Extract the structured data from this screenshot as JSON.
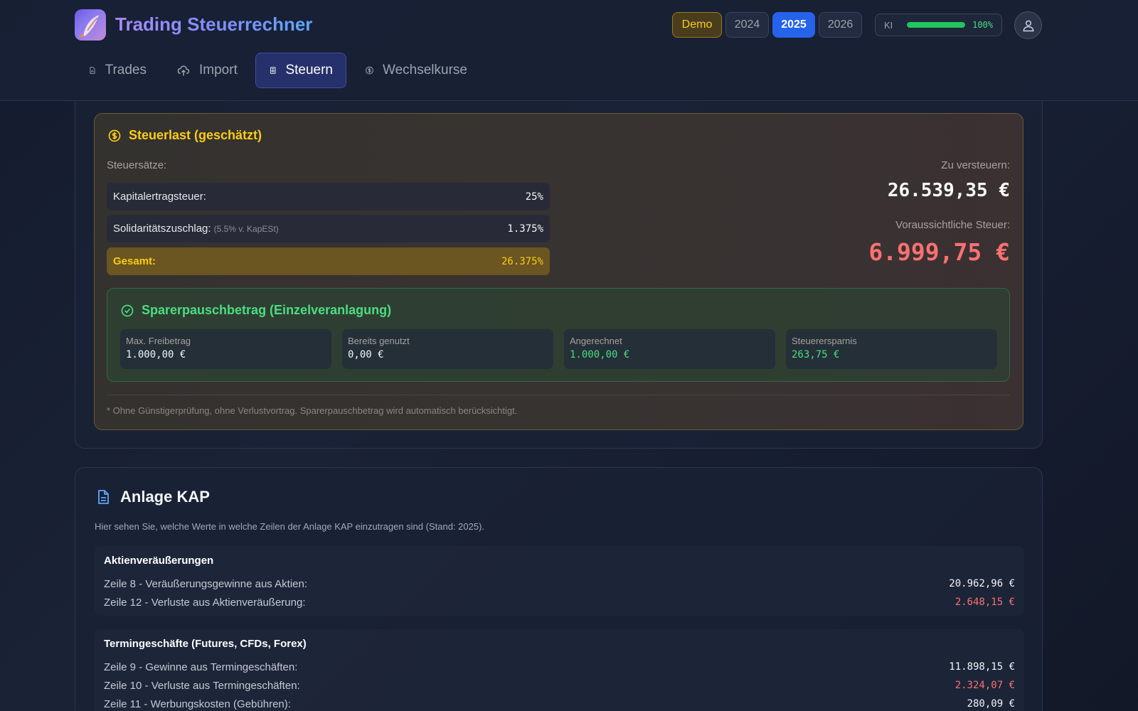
{
  "header": {
    "app_title": "Trading Steuerrechner",
    "badges": {
      "demo": "Demo"
    },
    "years": [
      "2024",
      "2025",
      "2026"
    ],
    "active_year": "2025",
    "ki": {
      "label": "KI",
      "percent_text": "100%",
      "level": 1.0
    },
    "nav": [
      {
        "label": "Trades",
        "icon": "chart-file-icon"
      },
      {
        "label": "Import",
        "icon": "upload-cloud-icon"
      },
      {
        "label": "Steuern",
        "icon": "calculator-icon"
      },
      {
        "label": "Wechselkurse",
        "icon": "dollar-circle-icon"
      }
    ],
    "active_nav": "Steuern"
  },
  "tax": {
    "title": "Steuerlast (geschätzt)",
    "rates_label": "Steuersätze:",
    "rates": [
      {
        "label": "Kapitalertragsteuer:",
        "hint": "",
        "value": "25%"
      },
      {
        "label": "Solidaritätszuschlag:",
        "hint": "(5.5% v. KapESt)",
        "value": "1.375%"
      },
      {
        "label": "Gesamt:",
        "hint": "",
        "value": "26.375%"
      }
    ],
    "taxable_label": "Zu versteuern:",
    "taxable_value": "26.539,35 €",
    "expected_label": "Voraussichtliche Steuer:",
    "expected_value": "6.999,75 €",
    "allowance": {
      "title": "Sparerpauschbetrag (Einzelveranlagung)",
      "cards": [
        {
          "label": "Max. Freibetrag",
          "value": "1.000,00 €"
        },
        {
          "label": "Bereits genutzt",
          "value": "0,00 €"
        },
        {
          "label": "Angerechnet",
          "value": "1.000,00 €"
        },
        {
          "label": "Steuerersparnis",
          "value": "263,75 €"
        }
      ]
    },
    "note": "* Ohne Günstigerprüfung, ohne Verlustvortrag. Sparerpauschbetrag wird automatisch berücksichtigt."
  },
  "kap": {
    "title": "Anlage KAP",
    "description": "Hier sehen Sie, welche Werte in welche Zeilen der Anlage KAP einzutragen sind (Stand: 2025).",
    "sections": [
      {
        "title": "Aktienveräußerungen",
        "rows": [
          {
            "label": "Zeile 8 - Veräußerungsgewinne aus Aktien:",
            "value": "20.962,96 €"
          },
          {
            "label": "Zeile 12 - Verluste aus Aktienveräußerung:",
            "value": "2.648,15 €"
          }
        ]
      },
      {
        "title": "Termingeschäfte (Futures, CFDs, Forex)",
        "rows": [
          {
            "label": "Zeile 9 - Gewinne aus Termingeschäften:",
            "value": "11.898,15 €"
          },
          {
            "label": "Zeile 10 - Verluste aus Termingeschäften:",
            "value": "2.324,07 €"
          },
          {
            "label": "Zeile 11 - Werbungskosten (Gebühren):",
            "value": "280,09 €"
          }
        ]
      }
    ]
  },
  "colors": {
    "accent": "#2563eb",
    "warning": "#facc15",
    "success": "#4ade80",
    "danger": "#f87171"
  }
}
